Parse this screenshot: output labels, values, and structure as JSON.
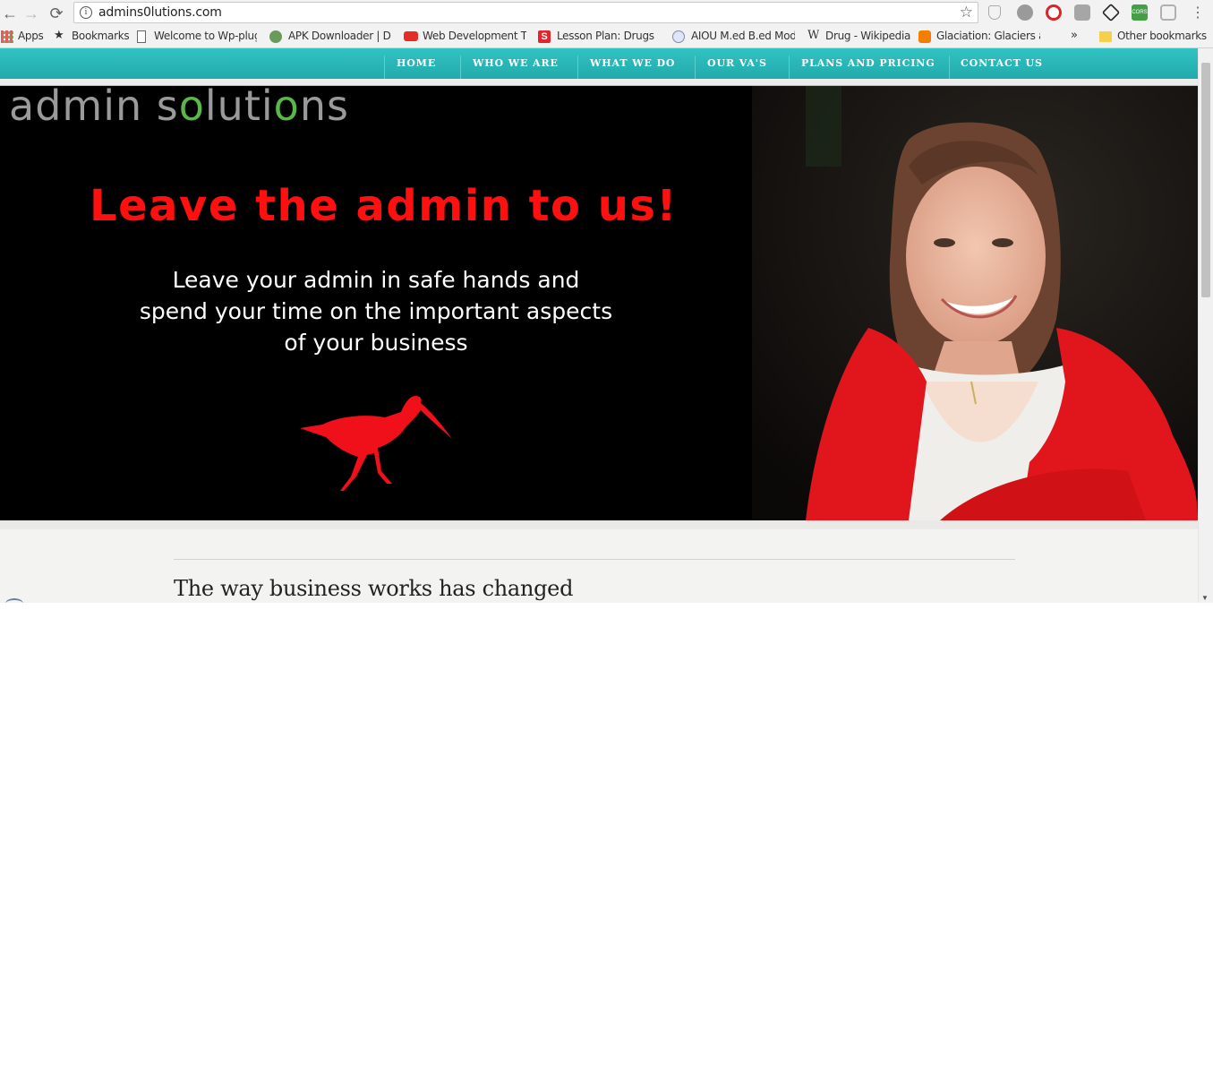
{
  "browser": {
    "url": "admins0lutions.com",
    "bookmarks": [
      {
        "label": "Apps"
      },
      {
        "label": "Bookmarks"
      },
      {
        "label": "Welcome to Wp-plug"
      },
      {
        "label": "APK Downloader | Do"
      },
      {
        "label": "Web Development Tu"
      },
      {
        "label": "Lesson Plan: Drugs +"
      },
      {
        "label": "AIOU M.ed B.ed Mode"
      },
      {
        "label": "Drug - Wikipedia"
      },
      {
        "label": "Glaciation: Glaciers as"
      }
    ],
    "overflow_label": "»",
    "other_bookmarks": "Other bookmarks"
  },
  "site": {
    "nav": [
      "HOME",
      "WHO WE ARE",
      "WHAT WE DO",
      "OUR VA'S",
      "PLANS AND PRICING",
      "CONTACT US"
    ],
    "logo": {
      "part1": "admin s",
      "gear1": "o",
      "part2": "luti",
      "gear2": "o",
      "part3": "ns"
    },
    "hero": {
      "headline": "Leave the admin to us!",
      "sub_line1": "Leave your admin in safe hands and",
      "sub_line2": "spend your time on the important aspects",
      "sub_line3": "of your business"
    },
    "section_heading": "The way business works has changed"
  },
  "colors": {
    "nav_teal": "#2bb5b6",
    "headline_red": "#ff1010",
    "logo_gear_green": "#58b947",
    "cardigan_red": "#e0161c"
  }
}
